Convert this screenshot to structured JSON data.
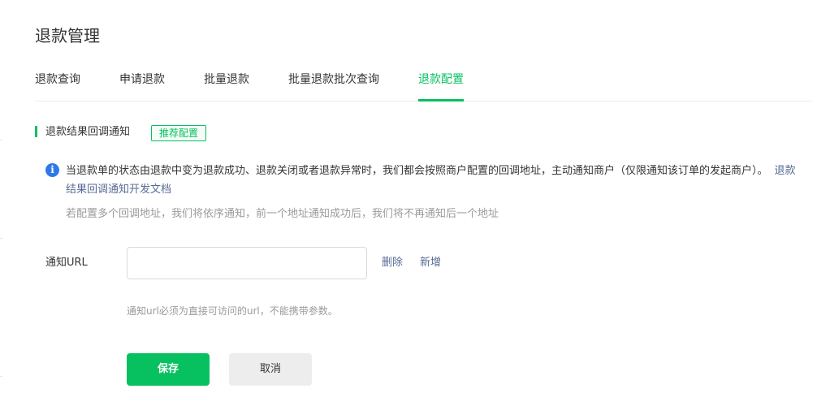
{
  "page": {
    "title": "退款管理"
  },
  "tabs": [
    {
      "label": "退款查询"
    },
    {
      "label": "申请退款"
    },
    {
      "label": "批量退款"
    },
    {
      "label": "批量退款批次查询"
    },
    {
      "label": "退款配置",
      "active": true
    }
  ],
  "section": {
    "title": "退款结果回调通知",
    "badge": "推荐配置"
  },
  "notice": {
    "text": "当退款单的状态由退款中变为退款成功、退款关闭或者退款异常时，我们都会按照商户配置的回调地址，主动通知商户（仅限通知该订单的发起商户）。",
    "link": "退款结果回调通知开发文档",
    "hint": "若配置多个回调地址，我们将依序通知，前一个地址通知成功后，我们将不再通知后一个地址"
  },
  "form": {
    "url_label": "通知URL",
    "url_value": "",
    "url_placeholder": "",
    "delete_label": "删除",
    "add_label": "新增",
    "url_hint": "通知url必须为直接可访问的url，不能携带参数。"
  },
  "actions": {
    "save_label": "保存",
    "cancel_label": "取消"
  },
  "colors": {
    "accent": "#07c160",
    "link": "#576b95",
    "info": "#2f78e8"
  },
  "icons": {
    "info": "info-icon"
  }
}
